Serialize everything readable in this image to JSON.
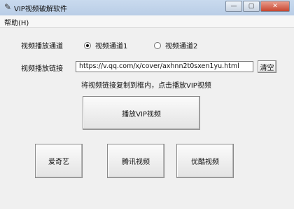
{
  "window": {
    "title": "VIP视频破解软件",
    "icon": "feather-icon",
    "controls": {
      "minimize": "—",
      "maximize": "▢",
      "close": "✕"
    }
  },
  "menu": {
    "help": "帮助(H)"
  },
  "channel": {
    "label": "视频播放通道",
    "options": [
      {
        "label": "视频通道1",
        "checked": true
      },
      {
        "label": "视频通道2",
        "checked": false
      }
    ]
  },
  "link": {
    "label": "视频播放链接",
    "value": "https://v.qq.com/x/cover/axhnn2t0sxen1yu.html",
    "clear_label": "清空"
  },
  "hint": "将视频链接复制到框内，点击播放VIP视频",
  "play_button": "播放VIP视频",
  "platforms": [
    "爱奇艺",
    "腾讯视频",
    "优酷视频"
  ]
}
